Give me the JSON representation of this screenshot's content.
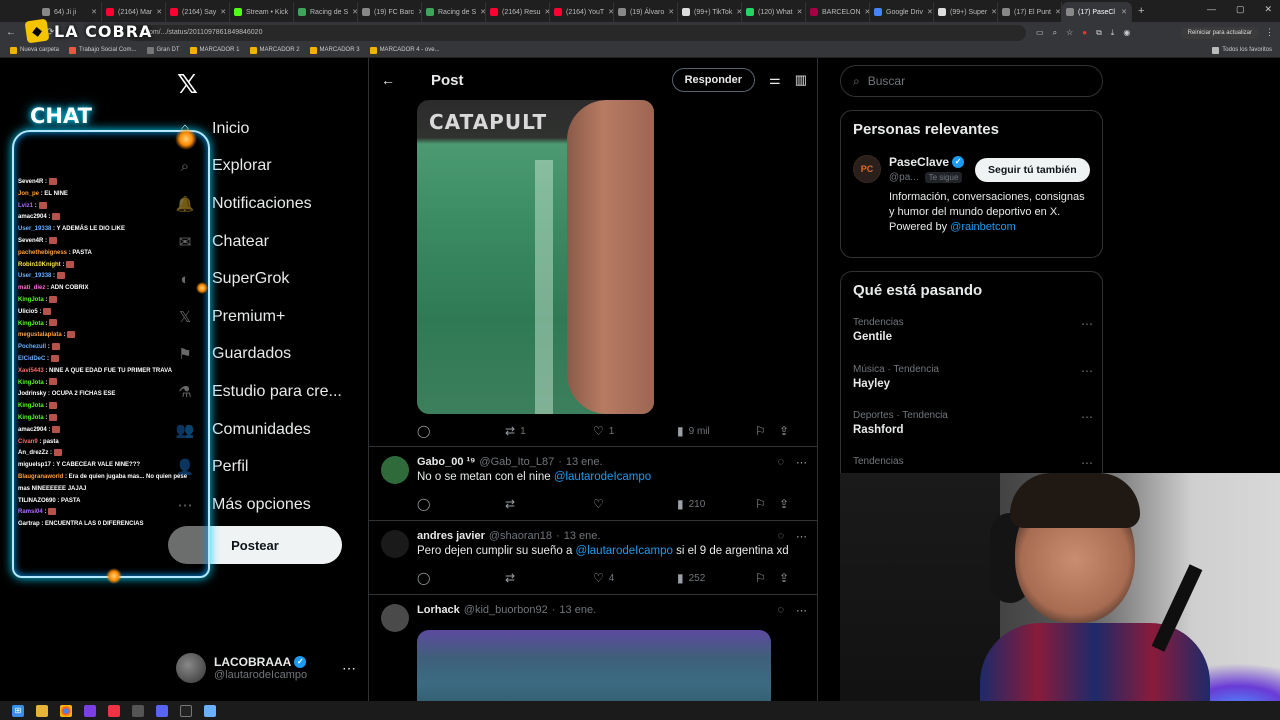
{
  "browser": {
    "tabs": [
      {
        "label": "64) Ji ji",
        "color": "#888"
      },
      {
        "label": "(2164) Mar",
        "color": "#ff0033"
      },
      {
        "label": "(2164) Say",
        "color": "#ff0033"
      },
      {
        "label": "Stream • Kick",
        "color": "#53fc18"
      },
      {
        "label": "Racing de S",
        "color": "#3ba55c"
      },
      {
        "label": "(19) FC Barc",
        "color": "#888"
      },
      {
        "label": "Racing de S",
        "color": "#3ba55c"
      },
      {
        "label": "(2164) Resu",
        "color": "#ff0033"
      },
      {
        "label": "(2164) YouT",
        "color": "#ff0033"
      },
      {
        "label": "(19) Álvaro",
        "color": "#888"
      },
      {
        "label": "(99+) TikTok",
        "color": "#ddd"
      },
      {
        "label": "(120) What",
        "color": "#25d366"
      },
      {
        "label": "BARCELON",
        "color": "#a50044"
      },
      {
        "label": "Google Driv",
        "color": "#4285f4"
      },
      {
        "label": "(99+) Super",
        "color": "#ddd"
      },
      {
        "label": "(17) El Punt",
        "color": "#888"
      },
      {
        "label": "(17) PaseCl",
        "color": "#888",
        "active": true
      }
    ],
    "url": "x.com/.../status/2011097861849846020",
    "update_label": "Reiniciar para actualizar",
    "bookmarks": [
      {
        "label": "Nueva carpeta",
        "color": "#f2b200"
      },
      {
        "label": "Trabajo Social Com...",
        "color": "#e54"
      },
      {
        "label": "Gran DT",
        "color": "#777"
      },
      {
        "label": "MARCADOR 1",
        "color": "#f2b200"
      },
      {
        "label": "MARCADOR 2",
        "color": "#f2b200"
      },
      {
        "label": "MARCADOR 3",
        "color": "#f2b200"
      },
      {
        "label": "MARCADOR 4 - ove...",
        "color": "#f2b200"
      }
    ],
    "all_bookmarks": "Todos los favoritos"
  },
  "overlay": {
    "brand": "LA COBRA",
    "chat_title": "CHAT",
    "chat": [
      {
        "user": "Seven4R",
        "color": "#ffffff",
        "msg": ":"
      },
      {
        "user": "Jon_pe",
        "color": "#ff9f3a",
        "msg": ": EL NINE"
      },
      {
        "user": "Lviz1",
        "color": "#b36cff",
        "msg": ":"
      },
      {
        "user": "amac2904",
        "color": "#ffffff",
        "msg": ":"
      },
      {
        "user": "User_19338",
        "color": "#6ab0ff",
        "msg": ": Y ADEMÁS LE DIO LIKE"
      },
      {
        "user": "Seven4R",
        "color": "#ffffff",
        "msg": ":"
      },
      {
        "user": "pachethebigness",
        "color": "#ff9f3a",
        "msg": ": PASTA"
      },
      {
        "user": "Robin10Knight",
        "color": "#ffe14a",
        "msg": ":"
      },
      {
        "user": "User_19338",
        "color": "#6ab0ff",
        "msg": ":"
      },
      {
        "user": "mati_diez",
        "color": "#ff6ad5",
        "msg": ": ADN COBRIX"
      },
      {
        "user": "KingJota",
        "color": "#53fc18",
        "msg": ":"
      },
      {
        "user": "Ulicio5",
        "color": "#ffffff",
        "msg": ":"
      },
      {
        "user": "KingJota",
        "color": "#53fc18",
        "msg": ":"
      },
      {
        "user": "megustalaplata",
        "color": "#ff9f3a",
        "msg": ":"
      },
      {
        "user": "Pochezull",
        "color": "#6ab0ff",
        "msg": ":"
      },
      {
        "user": "ElCidDeC",
        "color": "#6ab0ff",
        "msg": ":"
      },
      {
        "user": "Xavi5443",
        "color": "#ff6a6a",
        "msg": ": NINE A QUE EDAD FUE TU PRIMER TRAVA"
      },
      {
        "user": "KingJota",
        "color": "#53fc18",
        "msg": ":"
      },
      {
        "user": "Jodrinsky",
        "color": "#ffffff",
        "msg": ": OCUPA 2 FICHAS ESE"
      },
      {
        "user": "KingJota",
        "color": "#53fc18",
        "msg": ":"
      },
      {
        "user": "KingJota",
        "color": "#53fc18",
        "msg": ":"
      },
      {
        "user": "amac2904",
        "color": "#ffffff",
        "msg": ":"
      },
      {
        "user": "Civan9",
        "color": "#ff6a6a",
        "msg": ": pasta"
      },
      {
        "user": "An_drezZz",
        "color": "#ffffff",
        "msg": ":"
      },
      {
        "user": "miguelsp17",
        "color": "#ffffff",
        "msg": ": Y CABECEAR VALE NINE???"
      },
      {
        "user": "Blaugranaworld",
        "color": "#ff9f3a",
        "msg": ": Era de quien jugaba mas... No quien pese"
      },
      {
        "user": "mas NINEEEEEE JAJAJ",
        "color": "#ffffff",
        "msg": ""
      },
      {
        "user": "TILINAZO690",
        "color": "#ffffff",
        "msg": ": PASTA"
      },
      {
        "user": "Ramsi04",
        "color": "#b36cff",
        "msg": ":"
      },
      {
        "user": "Gartrap",
        "color": "#ffffff",
        "msg": ": ENCUENTRA LAS 0 DIFERENCIAS"
      }
    ]
  },
  "sidebar": {
    "nav": [
      {
        "label": "Inicio",
        "icon": "⌂",
        "name": "home"
      },
      {
        "label": "Explorar",
        "icon": "⌕",
        "name": "explore"
      },
      {
        "label": "Notificaciones",
        "icon": "🔔",
        "name": "notifications"
      },
      {
        "label": "Chatear",
        "icon": "✉",
        "name": "chat"
      },
      {
        "label": "SuperGrok",
        "icon": "◐",
        "name": "supergrok"
      },
      {
        "label": "Premium+",
        "icon": "𝕏",
        "name": "premium"
      },
      {
        "label": "Guardados",
        "icon": "⚑",
        "name": "bookmarks"
      },
      {
        "label": "Estudio para cre...",
        "icon": "⚗",
        "name": "creator-studio"
      },
      {
        "label": "Comunidades",
        "icon": "👥",
        "name": "communities"
      },
      {
        "label": "Perfil",
        "icon": "👤",
        "name": "profile"
      },
      {
        "label": "Más opciones",
        "icon": "⋯",
        "name": "more-options"
      }
    ],
    "post_button": "Postear",
    "profile": {
      "name": "LACOBRAAA",
      "handle": "@lautarodeIcampo"
    }
  },
  "post": {
    "header_title": "Post",
    "reply_button": "Responder",
    "media_text": "CATAPULT",
    "stats": {
      "replies": "",
      "reposts": "1",
      "likes": "1",
      "views": "9 mil"
    }
  },
  "replies": [
    {
      "name": "Gabo_00 ¹⁹",
      "handle": "@Gab_Ito_L87",
      "date": "13 ene.",
      "text": "No o se metan con el nine ",
      "mention": "@lautarodeIcampo",
      "text_after": "",
      "avatar_color": "#2f6b3a",
      "stats": {
        "replies": "",
        "reposts": "",
        "likes": "",
        "views": "210"
      }
    },
    {
      "name": "andres javier",
      "handle": "@shaoran18",
      "date": "13 ene.",
      "text": "Pero dejen cumplir su sueño a ",
      "mention": "@lautarodeIcampo",
      "text_after": " si el 9 de argentina xd",
      "avatar_color": "#1a1a1a",
      "stats": {
        "replies": "",
        "reposts": "",
        "likes": "4",
        "views": "252"
      }
    },
    {
      "name": "Lorhack",
      "handle": "@kid_buorbon92",
      "date": "13 ene.",
      "text": "",
      "mention": "",
      "text_after": "",
      "avatar_color": "#4a4a4a"
    }
  ],
  "right": {
    "search_placeholder": "Buscar",
    "relevant_title": "Personas relevantes",
    "relevant": {
      "name": "PaseClave",
      "handle": "@pa...",
      "tag": "Te sigue",
      "follow_label": "Seguir tú también",
      "bio": "Información, conversaciones, consignas y humor del mundo deportivo en X. Powered by ",
      "bio_mention": "@rainbetcom"
    },
    "trends_title": "Qué está pasando",
    "trends": [
      {
        "category": "Tendencias",
        "name": "Gentile"
      },
      {
        "category": "Música · Tendencia",
        "name": "Hayley"
      },
      {
        "category": "Deportes · Tendencia",
        "name": "Rashford"
      },
      {
        "category": "Tendencias",
        "name": ""
      }
    ]
  }
}
